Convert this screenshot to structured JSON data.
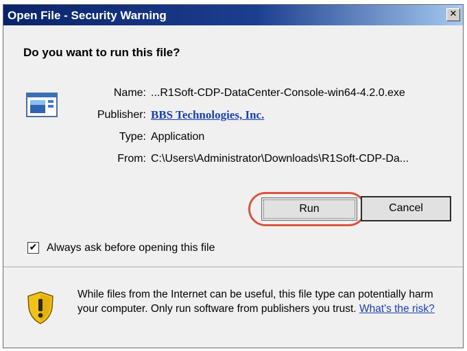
{
  "window": {
    "title": "Open File - Security Warning",
    "close_glyph": "✕"
  },
  "dialog": {
    "question": "Do you want to run this file?",
    "fields": {
      "name_label": "Name:",
      "name_value": "...R1Soft-CDP-DataCenter-Console-win64-4.2.0.exe",
      "publisher_label": "Publisher:",
      "publisher_value": "BBS Technologies, Inc.",
      "type_label": "Type:",
      "type_value": "Application",
      "from_label": "From:",
      "from_value": "C:\\Users\\Administrator\\Downloads\\R1Soft-CDP-Da..."
    },
    "buttons": {
      "run": "Run",
      "cancel": "Cancel"
    },
    "checkbox": {
      "label": "Always ask before opening this file",
      "checked": true,
      "check_glyph": "✔"
    },
    "warning": {
      "text": "While files from the Internet can be useful, this file type can potentially harm your computer. Only run software from publishers you trust.",
      "link": "What's the risk?"
    }
  },
  "colors": {
    "title_bar": "#0a246a",
    "link": "#1a3fb0",
    "highlight": "#d9553f",
    "shield_yellow": "#f2c21a"
  },
  "icons": {
    "file": "application-file-icon",
    "shield": "shield-warning-icon",
    "close": "close-icon"
  }
}
